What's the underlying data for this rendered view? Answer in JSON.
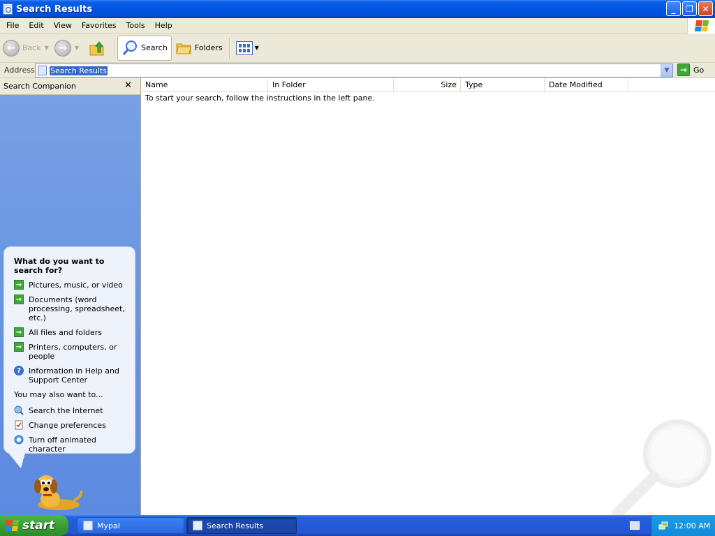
{
  "window": {
    "title": "Search Results",
    "buttons": {
      "minimize": "_",
      "restore": "❐",
      "close": "✕"
    }
  },
  "menubar": [
    "File",
    "Edit",
    "View",
    "Favorites",
    "Tools",
    "Help"
  ],
  "toolbar": {
    "back_label": "Back",
    "search_label": "Search",
    "folders_label": "Folders"
  },
  "address": {
    "label": "Address",
    "value": "Search Results",
    "go_label": "Go"
  },
  "left_pane": {
    "header": "Search Companion",
    "close_glyph": "✕",
    "question": "What do you want to search for?",
    "options": [
      "Pictures, music, or video",
      "Documents (word processing, spreadsheet, etc.)",
      "All files and folders",
      "Printers, computers, or people",
      "Information in Help and Support Center"
    ],
    "also_label": "You may also want to...",
    "also_options": [
      "Search the Internet",
      "Change preferences",
      "Turn off animated character"
    ]
  },
  "results": {
    "columns": [
      "Name",
      "In Folder",
      "Size",
      "Type",
      "Date Modified"
    ],
    "message": "To start your search, follow the instructions in the left pane."
  },
  "taskbar": {
    "start_label": "start",
    "tasks": [
      "Mypal",
      "Search Results"
    ],
    "clock": "12:00 AM"
  },
  "colors": {
    "titlebar": "#0054e3",
    "left_pane": "#6c97e2",
    "start_button": "#38a035",
    "tray": "#128ad8"
  },
  "icons": {
    "window": "search-results-icon",
    "up": "folder-up-icon",
    "search": "magnifier-icon",
    "folders": "folders-icon",
    "views": "views-icon",
    "go": "green-arrow-icon",
    "help": "help-question-icon",
    "internet": "globe-search-icon",
    "prefs": "checklist-icon",
    "character": "dog-character-icon"
  }
}
